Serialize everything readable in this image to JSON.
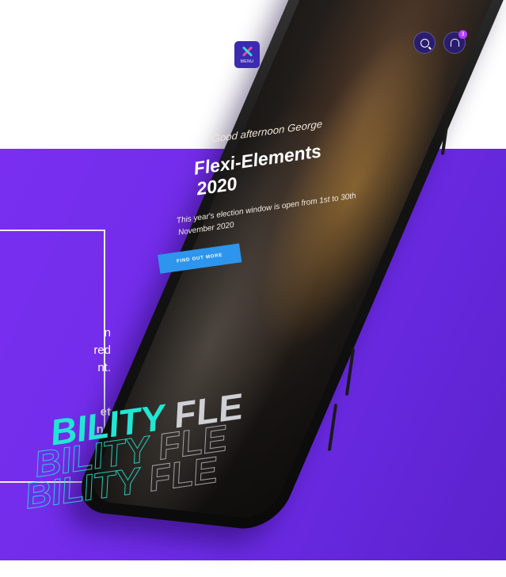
{
  "left_panel": {
    "text_normal": "n\nred\nnt.",
    "text_bold": "et\nnt."
  },
  "app": {
    "menu_label": "MENU",
    "notification_count": "3",
    "greeting": "Good afternoon George",
    "title_line1": "Flexi-Elements",
    "title_line2": "2020",
    "body": "This year's election window is open from 1st to 30th November 2020",
    "cta_label": "FIND OUT MORE",
    "marquee_teal": "BILITY",
    "marquee_grey": "FLE"
  },
  "colors": {
    "purple": "#6d2be6",
    "cta_blue": "#2d95ee",
    "teal": "#22e6d3",
    "badge": "#b43cff"
  },
  "icons": [
    "menu-x-icon",
    "search-icon",
    "bell-icon"
  ]
}
